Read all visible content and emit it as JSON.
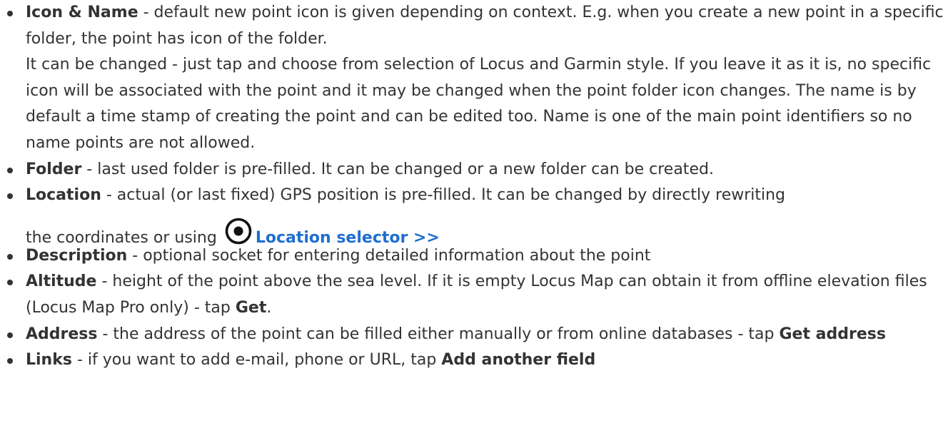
{
  "colors": {
    "text": "#333333",
    "link": "#1e6fd0"
  },
  "items": [
    {
      "term": "Icon & Name",
      "text1": " - default new point icon is given depending on context. E.g. when you create a new point in a specific folder, the point has icon of the folder.",
      "text2": "It can be changed - just tap and choose from selection of Locus and Garmin style. If you leave it as it is, no specific icon will be associated with the point and it may be changed when the point folder icon changes. The name is by default a time stamp of creating the point and can be edited too. Name is one of the main point identifiers so no name points are not allowed."
    },
    {
      "term": "Folder",
      "text": " - last used folder is pre-filled. It can be changed or a new folder can be created."
    },
    {
      "term": "Location",
      "text": " - actual (or last fixed) GPS position is pre-filled. It can be changed by directly rewriting",
      "text_cont": "the coordinates or using",
      "icon": "target-icon",
      "link": "Location selector >>"
    },
    {
      "term": "Description",
      "text": " - optional socket for entering detailed information about the point"
    },
    {
      "term": "Altitude",
      "text": " - height of the point above the sea level. If it is empty Locus Map can obtain it from offline elevation files (Locus Map Pro only) - tap ",
      "action": "Get",
      "after": "."
    },
    {
      "term": "Address",
      "text": " - the address of the point can be filled either manually or from online databases - tap ",
      "action": "Get address"
    },
    {
      "term": "Links",
      "text": " - if you want to add e-mail, phone or URL, tap ",
      "action": "Add another field"
    }
  ]
}
